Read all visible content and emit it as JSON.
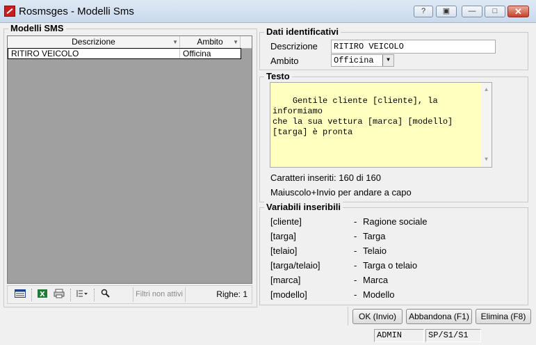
{
  "window": {
    "title": "Rosmsges - Modelli Sms"
  },
  "left_panel": {
    "title": "Modelli SMS",
    "columns": [
      "Descrizione",
      "Ambito"
    ],
    "rows": [
      {
        "descrizione": "RITIRO VEICOLO",
        "ambito": "Officina"
      }
    ],
    "filter_text": "Filtri non attivi",
    "row_count": "Righe: 1"
  },
  "dati": {
    "title": "Dati identificativi",
    "descrizione_label": "Descrizione",
    "descrizione_value": "RITIRO VEICOLO",
    "ambito_label": "Ambito",
    "ambito_value": "Officina"
  },
  "testo": {
    "title": "Testo",
    "content": "Gentile cliente [cliente], la informiamo\nche la sua vettura [marca] [modello]\n[targa] è pronta",
    "chars": "Caratteri inseriti: 160 di 160",
    "hint": "Maiuscolo+Invio per andare a capo"
  },
  "variabili": {
    "title": "Variabili inseribili",
    "items": [
      {
        "var": "[cliente]",
        "dash": "-",
        "desc": "Ragione sociale"
      },
      {
        "var": "[targa]",
        "dash": "-",
        "desc": "Targa"
      },
      {
        "var": "[telaio]",
        "dash": "-",
        "desc": "Telaio"
      },
      {
        "var": "[targa/telaio]",
        "dash": "-",
        "desc": "Targa o telaio"
      },
      {
        "var": "[marca]",
        "dash": "-",
        "desc": "Marca"
      },
      {
        "var": "[modello]",
        "dash": "-",
        "desc": "Modello"
      }
    ]
  },
  "buttons": {
    "ok": "OK (Invio)",
    "abbandona": "Abbandona (F1)",
    "elimina": "Elimina (F8)"
  },
  "statusbar": {
    "user": "ADMIN",
    "code": "SP/S1/S1"
  },
  "colors": {
    "textarea_bg": "#ffffc0",
    "grid_bg": "#a0a0a0",
    "close_button": "#c7412b"
  }
}
